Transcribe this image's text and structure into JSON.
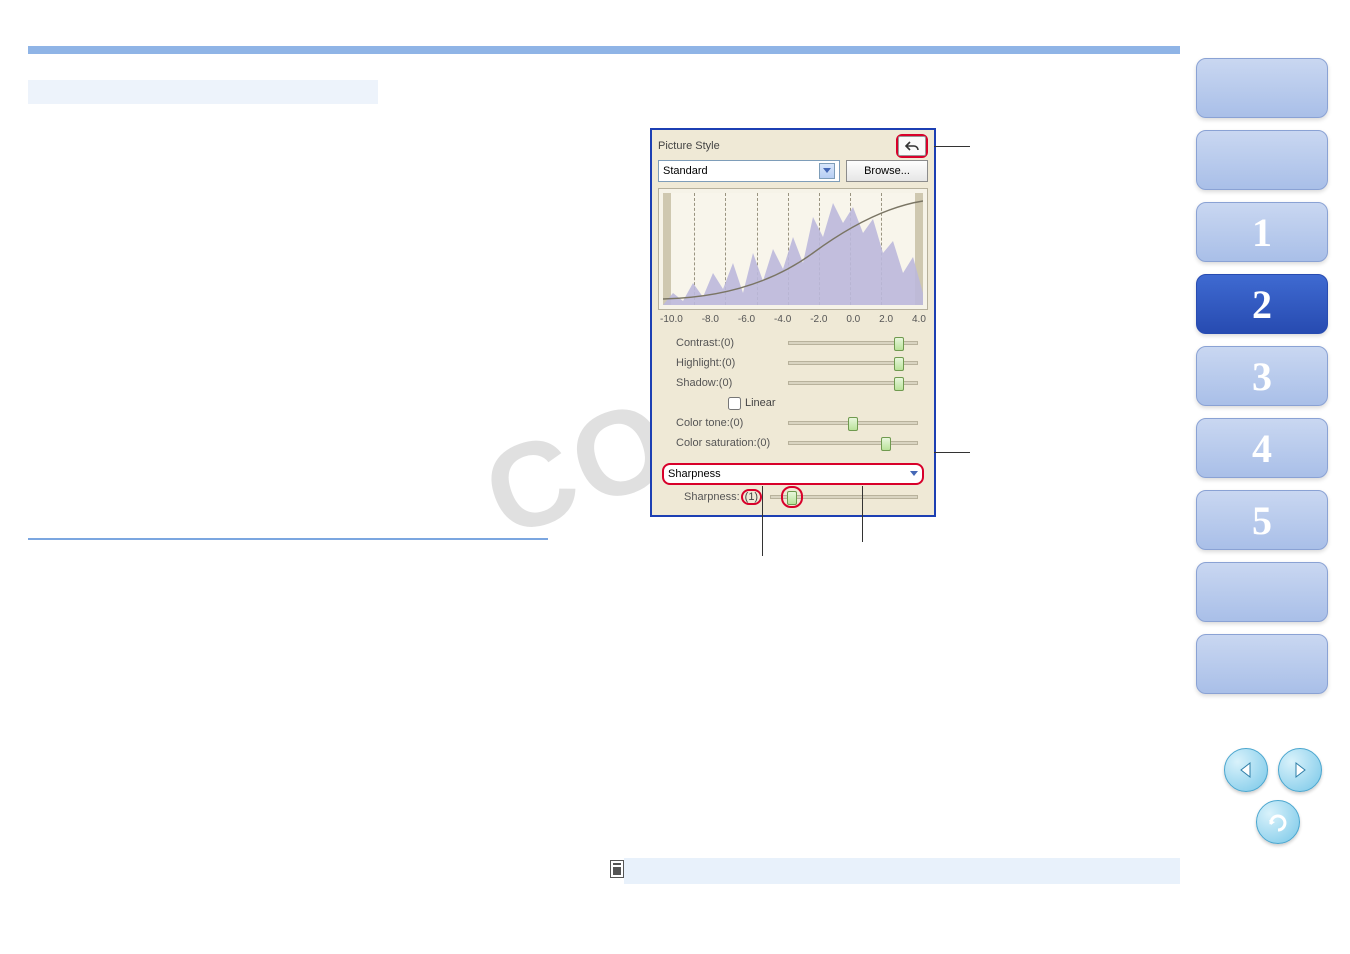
{
  "panel": {
    "title": "Picture Style",
    "style_select": "Standard",
    "browse_label": "Browse...",
    "ticks": [
      "-10.0",
      "-8.0",
      "-6.0",
      "-4.0",
      "-2.0",
      "0.0",
      "2.0",
      "4.0"
    ],
    "sliders": {
      "contrast_label": "Contrast:(0)",
      "highlight_label": "Highlight:(0)",
      "shadow_label": "Shadow:(0)",
      "linear_label": "Linear",
      "color_tone_label": "Color tone:(0)",
      "color_saturation_label": "Color saturation:(0)"
    },
    "sharpness_dd": "Sharpness",
    "sharpness_row": {
      "label": "Sharpness:",
      "value": "(1)"
    }
  },
  "sidenav": {
    "items": [
      {
        "label": ""
      },
      {
        "label": ""
      },
      {
        "label": "1"
      },
      {
        "label": "2",
        "active": true
      },
      {
        "label": "3"
      },
      {
        "label": "4"
      },
      {
        "label": "5"
      },
      {
        "label": ""
      },
      {
        "label": ""
      }
    ]
  },
  "watermark": "COPY"
}
